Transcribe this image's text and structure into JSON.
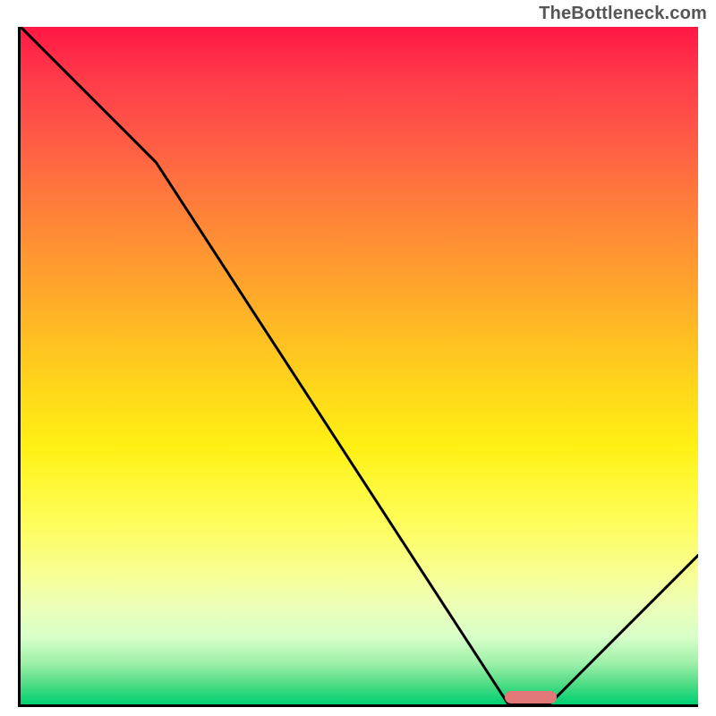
{
  "watermark": "TheBottleneck.com",
  "chart_data": {
    "type": "line",
    "title": "",
    "xlabel": "",
    "ylabel": "",
    "xlim": [
      0,
      100
    ],
    "ylim": [
      0,
      100
    ],
    "series": [
      {
        "name": "curve",
        "x": [
          0,
          20,
          72,
          78,
          100
        ],
        "values": [
          100,
          80,
          0,
          0,
          22
        ]
      }
    ],
    "marker": {
      "x_center": 75,
      "y": 1.5,
      "width_pct": 7.6
    },
    "background_gradient": {
      "direction": "vertical",
      "stops": [
        {
          "pct": 0,
          "color": "#ff1744"
        },
        {
          "pct": 50,
          "color": "#ffd400"
        },
        {
          "pct": 80,
          "color": "#f9ff80"
        },
        {
          "pct": 100,
          "color": "#00d072"
        }
      ]
    },
    "axes": {
      "show_ticks": false,
      "show_grid": false
    }
  }
}
